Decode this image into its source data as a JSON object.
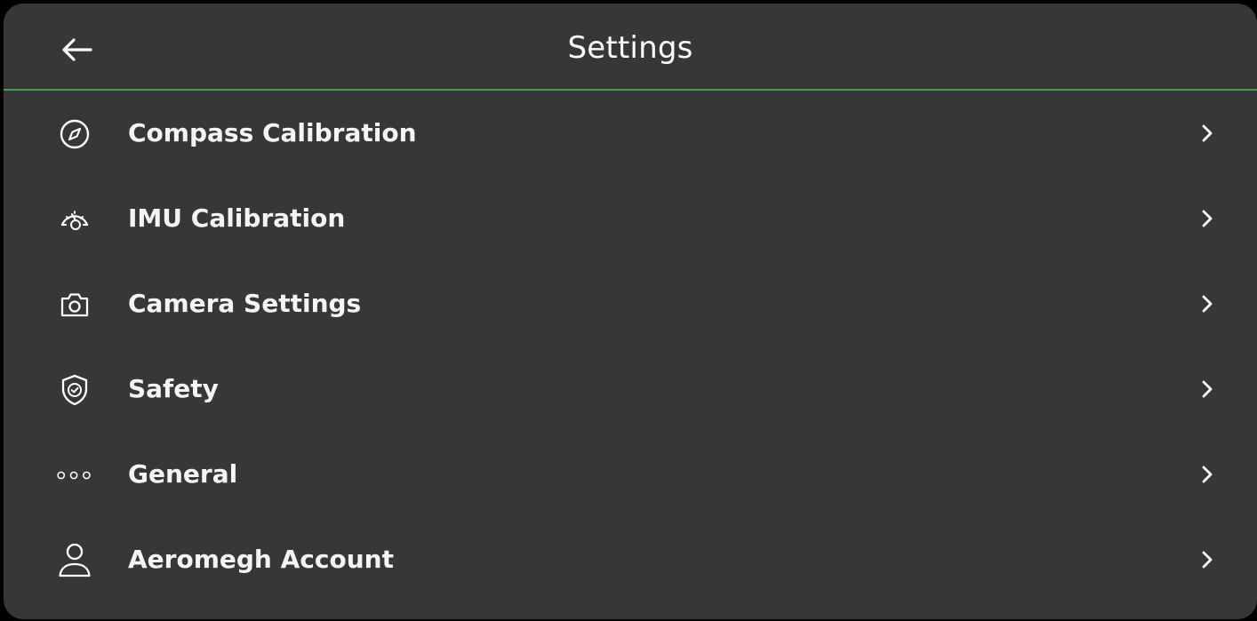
{
  "header": {
    "title": "Settings",
    "back_icon": "arrow-left-icon"
  },
  "menu": {
    "items": [
      {
        "label": "Compass Calibration",
        "icon": "compass-icon"
      },
      {
        "label": "IMU Calibration",
        "icon": "gauge-icon"
      },
      {
        "label": "Camera Settings",
        "icon": "camera-icon"
      },
      {
        "label": "Safety",
        "icon": "shield-check-icon"
      },
      {
        "label": "General",
        "icon": "more-dots-icon"
      },
      {
        "label": "Aeromegh Account",
        "icon": "user-icon"
      }
    ],
    "chevron_icon": "chevron-right-icon"
  },
  "colors": {
    "background": "#373737",
    "divider": "#3fa34d",
    "text": "#ffffff"
  }
}
